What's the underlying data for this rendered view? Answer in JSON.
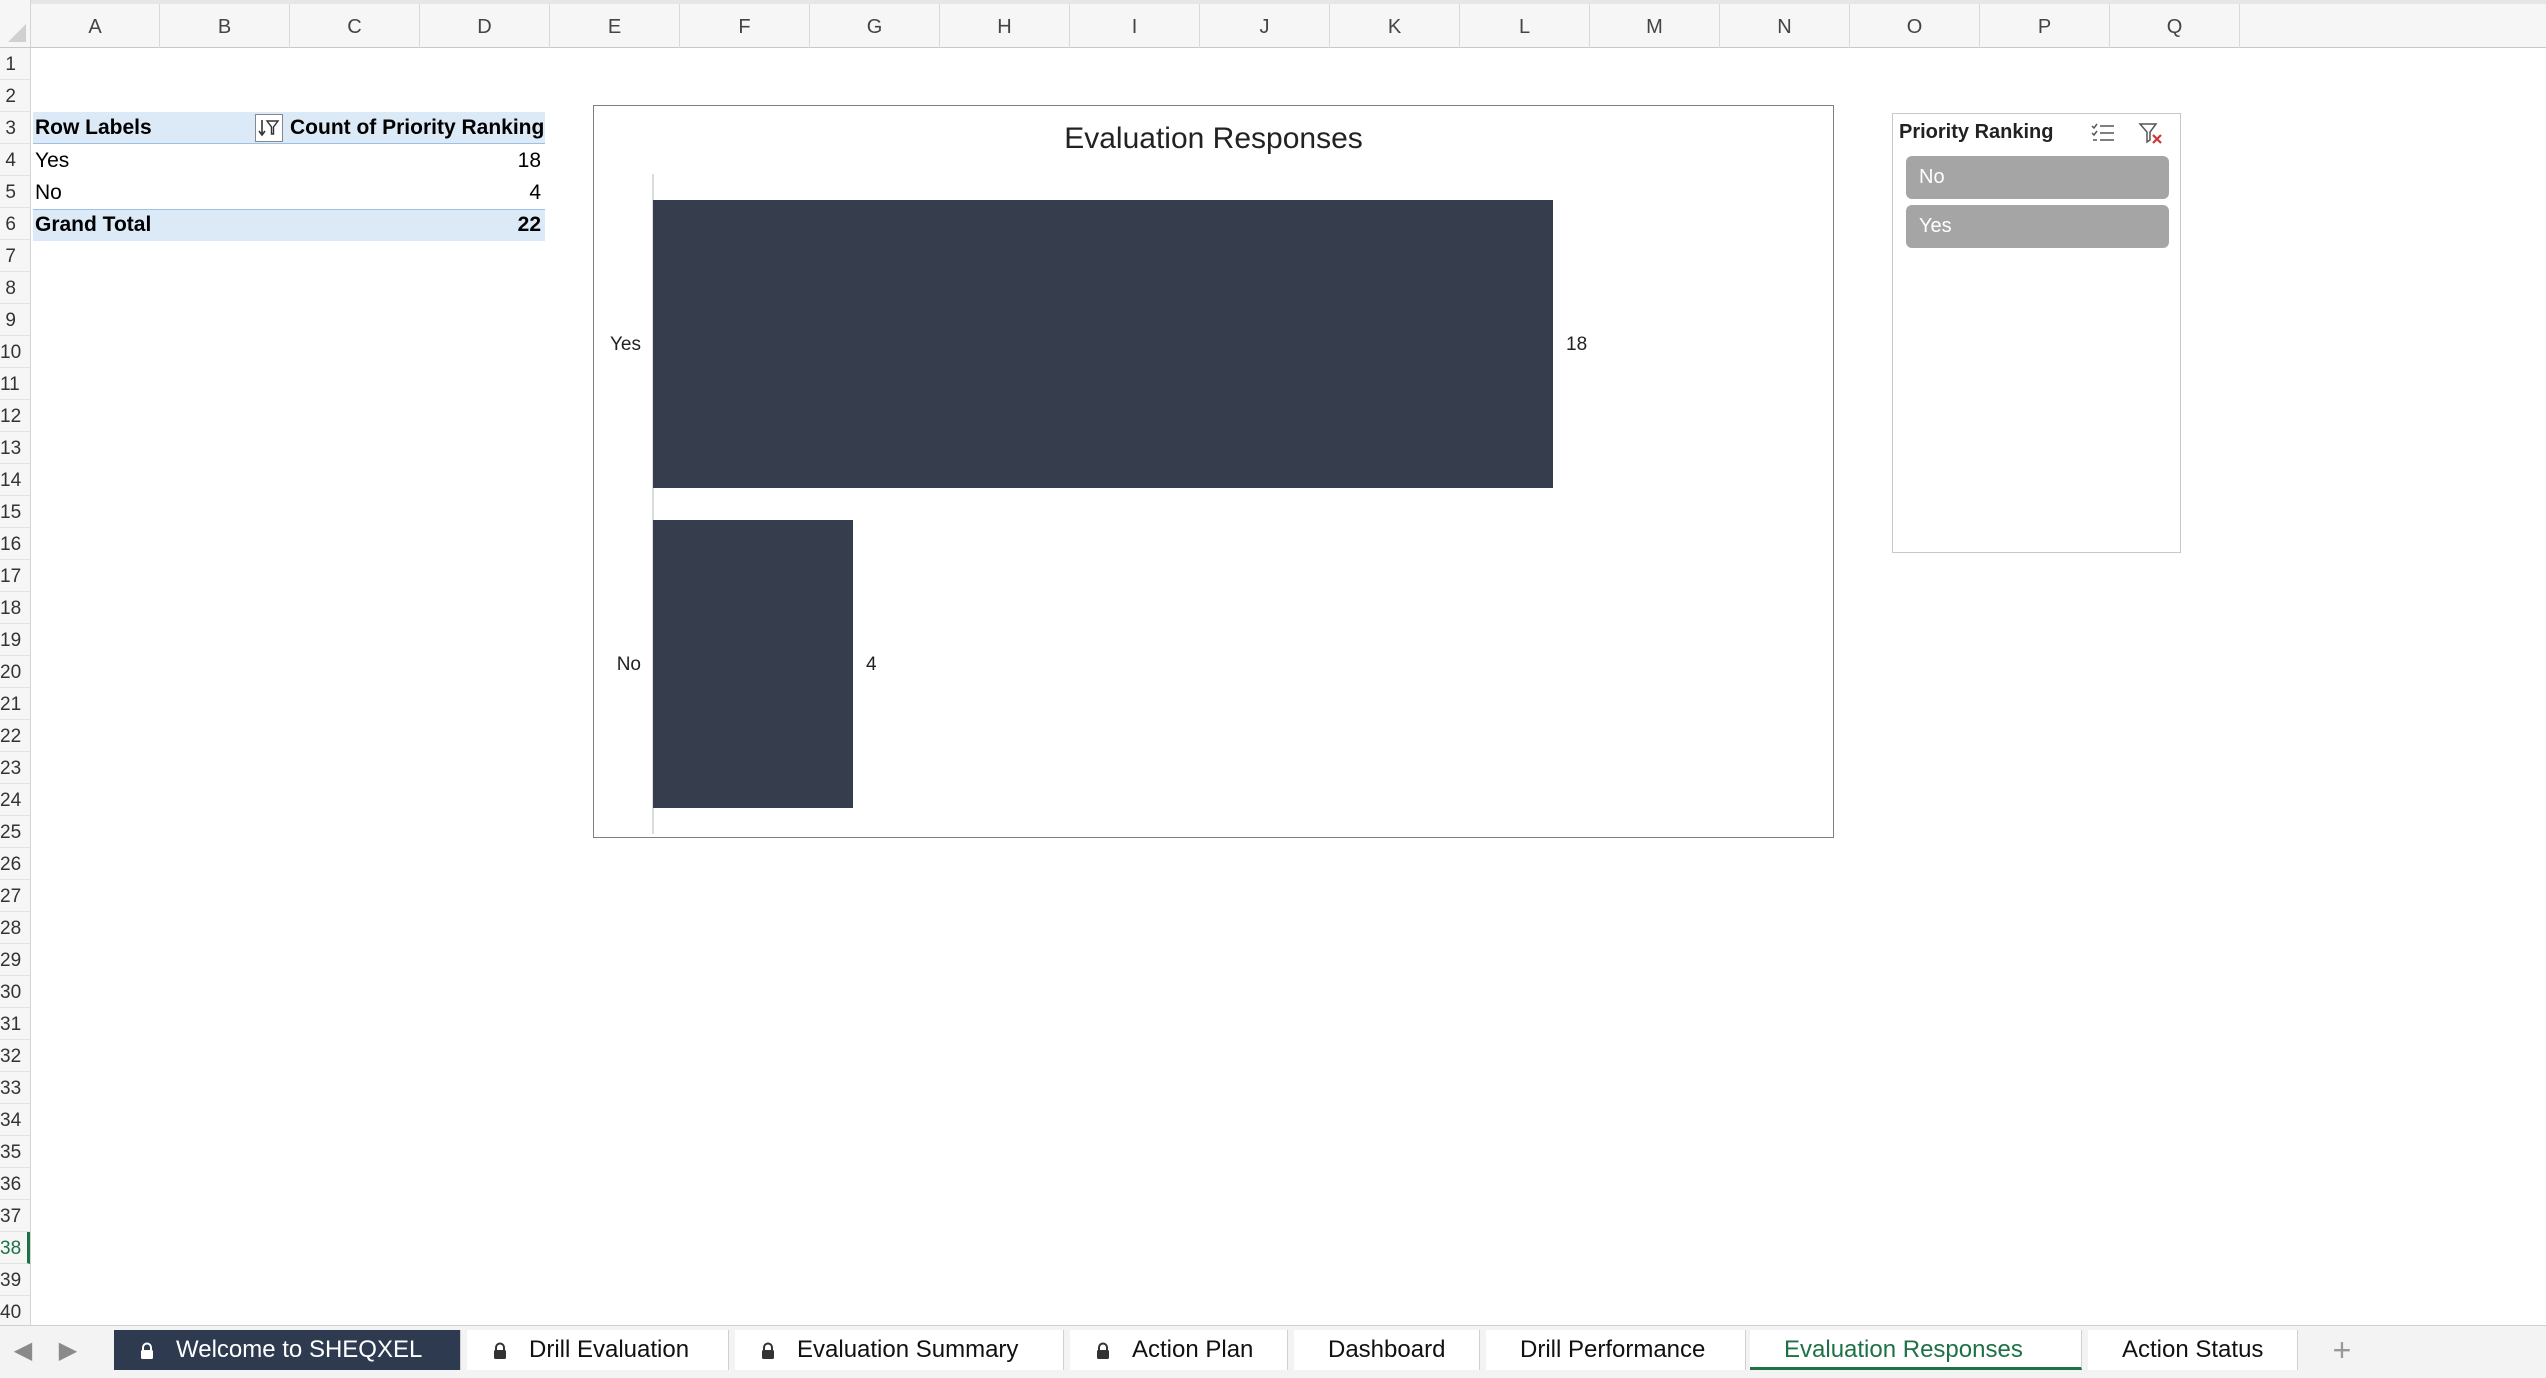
{
  "columns": [
    "A",
    "B",
    "C",
    "D",
    "E",
    "F",
    "G",
    "H",
    "I",
    "J",
    "K",
    "L",
    "M",
    "N",
    "O",
    "P",
    "Q"
  ],
  "rows": [
    "1",
    "2",
    "3",
    "4",
    "5",
    "6",
    "7",
    "8",
    "9",
    "10",
    "11",
    "12",
    "13",
    "14",
    "15",
    "16",
    "17",
    "18",
    "19",
    "20",
    "21",
    "22",
    "23",
    "24",
    "25",
    "26",
    "27",
    "28",
    "29",
    "30",
    "31",
    "32",
    "33",
    "34",
    "35",
    "36",
    "37",
    "38",
    "39",
    "40"
  ],
  "active_row": "38",
  "pivot": {
    "header_label": "Row Labels",
    "header_value": "Count of Priority Ranking",
    "rows": [
      {
        "label": "Yes",
        "value": "18"
      },
      {
        "label": "No",
        "value": "4"
      }
    ],
    "total_label": "Grand Total",
    "total_value": "22"
  },
  "chart_data": {
    "type": "bar",
    "orientation": "horizontal",
    "title": "Evaluation Responses",
    "categories": [
      "Yes",
      "No"
    ],
    "values": [
      18,
      4
    ],
    "xlabel": "",
    "ylabel": "",
    "xlim": [
      0,
      20
    ],
    "grid": false,
    "legend": "none",
    "bar_color": "#363e4d"
  },
  "slicer": {
    "title": "Priority Ranking",
    "multiselect_icon": "multi-select-icon",
    "clear_filter_icon": "clear-filter-icon",
    "items": [
      "No",
      "Yes"
    ]
  },
  "tabs": [
    {
      "label": "Welcome to SHEQXEL",
      "locked": true,
      "style": "dark"
    },
    {
      "label": "Drill Evaluation",
      "locked": true,
      "style": "normal"
    },
    {
      "label": "Evaluation Summary",
      "locked": true,
      "style": "normal"
    },
    {
      "label": "Action Plan",
      "locked": true,
      "style": "normal"
    },
    {
      "label": "Dashboard",
      "locked": false,
      "style": "normal"
    },
    {
      "label": "Drill Performance",
      "locked": false,
      "style": "normal"
    },
    {
      "label": "Evaluation Responses",
      "locked": false,
      "style": "active"
    },
    {
      "label": "Action Status",
      "locked": false,
      "style": "normal"
    }
  ],
  "add_sheet_label": "+",
  "nav_prev": "◀",
  "nav_next": "▶",
  "colors": {
    "active_green": "#1e7145",
    "pivot_header_bg": "#dce9f7",
    "slicer_item_bg": "#a5a5a5",
    "dark_tab_bg": "#2e3a4f"
  }
}
